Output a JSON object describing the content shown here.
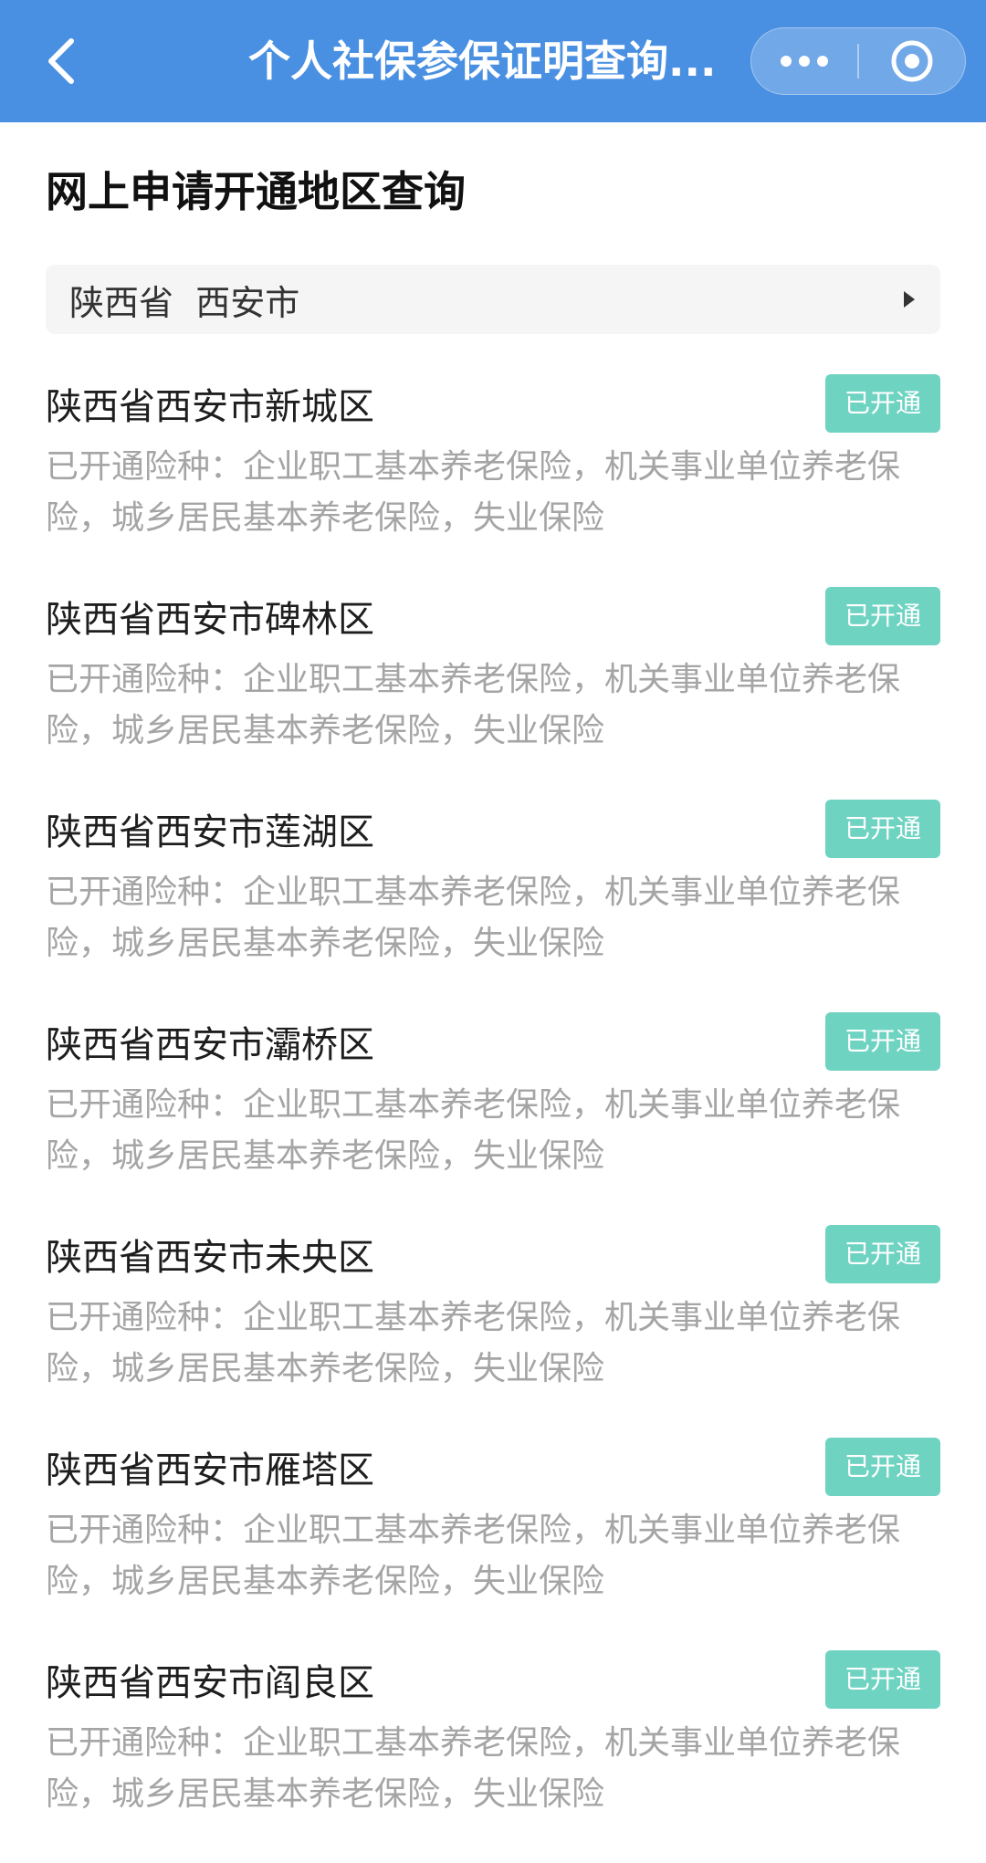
{
  "navbar": {
    "title": "个人社保参保证明查询...",
    "back_icon": "chevron-left-icon",
    "more_icon": "more-dots-icon",
    "close_icon": "target-circle-icon",
    "background_color": "#4a90e2"
  },
  "page": {
    "heading": "网上申请开通地区查询"
  },
  "region_selector": {
    "province": "陕西省",
    "city": "西安市",
    "arrow_icon": "triangle-right-icon"
  },
  "badge_color": "#6fd3c2",
  "regions": [
    {
      "name": "陕西省西安市新城区",
      "status": "已开通",
      "description": "已开通险种：企业职工基本养老保险，机关事业单位养老保险，城乡居民基本养老保险，失业保险"
    },
    {
      "name": "陕西省西安市碑林区",
      "status": "已开通",
      "description": "已开通险种：企业职工基本养老保险，机关事业单位养老保险，城乡居民基本养老保险，失业保险"
    },
    {
      "name": "陕西省西安市莲湖区",
      "status": "已开通",
      "description": "已开通险种：企业职工基本养老保险，机关事业单位养老保险，城乡居民基本养老保险，失业保险"
    },
    {
      "name": "陕西省西安市灞桥区",
      "status": "已开通",
      "description": "已开通险种：企业职工基本养老保险，机关事业单位养老保险，城乡居民基本养老保险，失业保险"
    },
    {
      "name": "陕西省西安市未央区",
      "status": "已开通",
      "description": "已开通险种：企业职工基本养老保险，机关事业单位养老保险，城乡居民基本养老保险，失业保险"
    },
    {
      "name": "陕西省西安市雁塔区",
      "status": "已开通",
      "description": "已开通险种：企业职工基本养老保险，机关事业单位养老保险，城乡居民基本养老保险，失业保险"
    },
    {
      "name": "陕西省西安市阎良区",
      "status": "已开通",
      "description": "已开通险种：企业职工基本养老保险，机关事业单位养老保险，城乡居民基本养老保险，失业保险"
    }
  ]
}
